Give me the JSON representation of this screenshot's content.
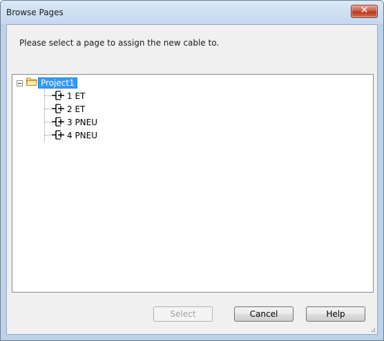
{
  "window": {
    "title": "Browse Pages",
    "close_glyph": "✕"
  },
  "prompt": "Please select a page to assign the new cable to.",
  "tree": {
    "root": {
      "label": "Project1",
      "icon": "folder-icon",
      "expanded": true,
      "selected": true
    },
    "pages": [
      {
        "number": "1",
        "name": "ET",
        "icon": "schematic-page-icon"
      },
      {
        "number": "2",
        "name": "ET",
        "icon": "schematic-page-icon"
      },
      {
        "number": "3",
        "name": "PNEU",
        "icon": "schematic-page-icon"
      },
      {
        "number": "4",
        "name": "PNEU",
        "icon": "schematic-page-icon"
      }
    ]
  },
  "buttons": {
    "select": {
      "label": "Select",
      "enabled": false
    },
    "cancel": {
      "label": "Cancel",
      "enabled": true
    },
    "help": {
      "label": "Help",
      "enabled": true
    }
  },
  "colors": {
    "selection": "#3399ff",
    "close_button": "#c8563e",
    "frame": "#bcd2ea"
  }
}
